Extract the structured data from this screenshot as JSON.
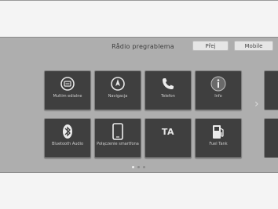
{
  "header": {
    "title": "Rådio pregrablema",
    "buttons": [
      "Přej",
      "Mobile"
    ]
  },
  "tiles": [
    {
      "label": "Multim edialne",
      "icon": "media-player-icon"
    },
    {
      "label": "Navigacja",
      "icon": "navigation-icon"
    },
    {
      "label": "Telefon",
      "icon": "phone-icon"
    },
    {
      "label": "Info",
      "icon": "info-icon"
    },
    {
      "label": "Bluetooth Audio",
      "icon": "bluetooth-icon"
    },
    {
      "label": "Połączenie smartfona",
      "icon": "smartphone-icon"
    },
    {
      "label": "",
      "icon": "ta-icon",
      "icon_text": "TA"
    },
    {
      "label": "Fuel Tank",
      "icon": "fuel-icon"
    }
  ],
  "pager": {
    "pages": 3,
    "active": 1
  }
}
